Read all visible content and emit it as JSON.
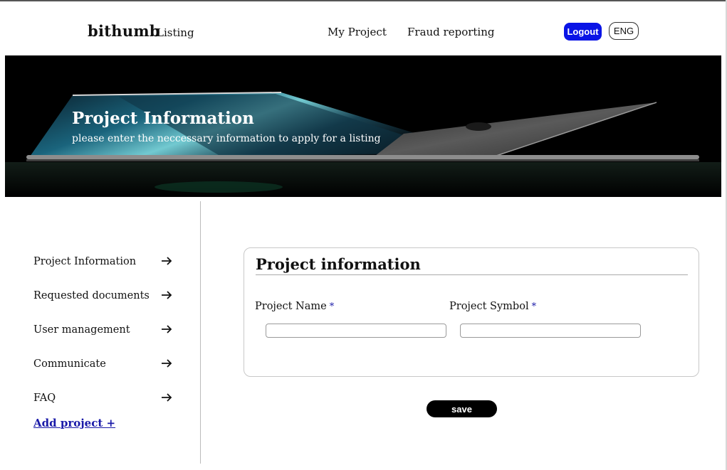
{
  "header": {
    "brand": "bithumb",
    "brand_sub": "Listing",
    "nav": [
      {
        "label": "My Project"
      },
      {
        "label": "Fraud reporting"
      }
    ],
    "logout_label": "Logout",
    "language_label": "ENG",
    "logout_color": "#0a14e6"
  },
  "hero": {
    "title": "Project Information",
    "subtitle": "please enter the neccessary information to apply for a listing"
  },
  "sidebar": {
    "items": [
      {
        "label": "Project Information",
        "icon": "arrow-right-icon"
      },
      {
        "label": "Requested documents",
        "icon": "arrow-right-icon"
      },
      {
        "label": "User management",
        "icon": "arrow-right-icon"
      },
      {
        "label": "Communicate",
        "icon": "arrow-right-icon"
      },
      {
        "label": "FAQ",
        "icon": "arrow-right-icon"
      }
    ],
    "add_project": "Add project +"
  },
  "form": {
    "title": "Project information",
    "fields": [
      {
        "label": "Project Name",
        "required_mark": "*",
        "value": "",
        "placeholder": ""
      },
      {
        "label": "Project Symbol",
        "required_mark": "*",
        "value": "",
        "placeholder": ""
      }
    ],
    "save_label": "save"
  }
}
